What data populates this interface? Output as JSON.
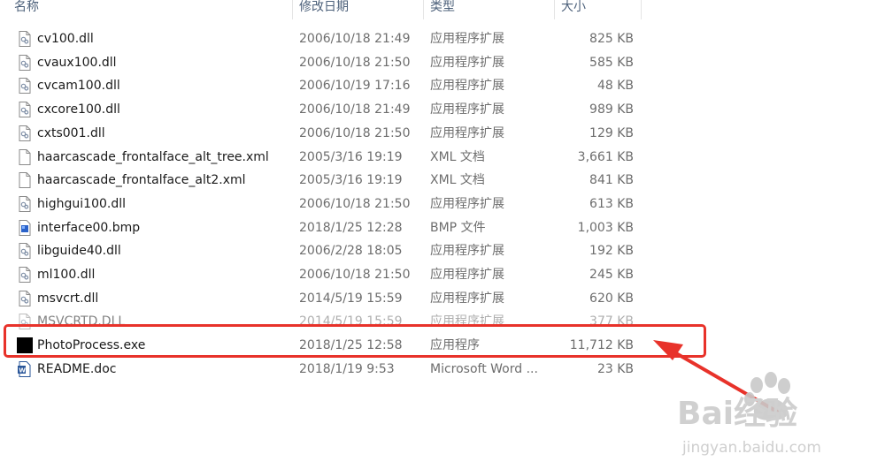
{
  "columns": {
    "name": "名称",
    "date": "修改日期",
    "type": "类型",
    "size": "大小"
  },
  "files": [
    {
      "name": "cv100.dll",
      "date": "2006/10/18 21:49",
      "type": "应用程序扩展",
      "size": "825 KB",
      "icon": "dll-icon"
    },
    {
      "name": "cvaux100.dll",
      "date": "2006/10/18 21:50",
      "type": "应用程序扩展",
      "size": "585 KB",
      "icon": "dll-icon"
    },
    {
      "name": "cvcam100.dll",
      "date": "2006/10/19 17:16",
      "type": "应用程序扩展",
      "size": "48 KB",
      "icon": "dll-icon"
    },
    {
      "name": "cxcore100.dll",
      "date": "2006/10/18 21:49",
      "type": "应用程序扩展",
      "size": "989 KB",
      "icon": "dll-icon"
    },
    {
      "name": "cxts001.dll",
      "date": "2006/10/18 21:50",
      "type": "应用程序扩展",
      "size": "129 KB",
      "icon": "dll-icon"
    },
    {
      "name": "haarcascade_frontalface_alt_tree.xml",
      "date": "2005/3/16 19:19",
      "type": "XML 文档",
      "size": "3,661 KB",
      "icon": "xml-file-icon"
    },
    {
      "name": "haarcascade_frontalface_alt2.xml",
      "date": "2005/3/16 19:19",
      "type": "XML 文档",
      "size": "841 KB",
      "icon": "xml-file-icon"
    },
    {
      "name": "highgui100.dll",
      "date": "2006/10/18 21:50",
      "type": "应用程序扩展",
      "size": "613 KB",
      "icon": "dll-icon"
    },
    {
      "name": "interface00.bmp",
      "date": "2018/1/25 12:28",
      "type": "BMP 文件",
      "size": "1,003 KB",
      "icon": "bmp-file-icon"
    },
    {
      "name": "libguide40.dll",
      "date": "2006/2/28 18:05",
      "type": "应用程序扩展",
      "size": "192 KB",
      "icon": "dll-icon"
    },
    {
      "name": "ml100.dll",
      "date": "2006/10/18 21:50",
      "type": "应用程序扩展",
      "size": "245 KB",
      "icon": "dll-icon"
    },
    {
      "name": "msvcrt.dll",
      "date": "2014/5/19 15:59",
      "type": "应用程序扩展",
      "size": "620 KB",
      "icon": "dll-icon"
    },
    {
      "name": "MSVCRTD.DLL",
      "date": "2014/5/19 15:59",
      "type": "应用程序扩展",
      "size": "377 KB",
      "icon": "dll-icon"
    },
    {
      "name": "PhotoProcess.exe",
      "date": "2018/1/25 12:58",
      "type": "应用程序",
      "size": "11,712 KB",
      "icon": "exe-icon"
    },
    {
      "name": "README.doc",
      "date": "2018/1/19 9:53",
      "type": "Microsoft Word ...",
      "size": "23 KB",
      "icon": "word-doc-icon"
    }
  ],
  "annotation": {
    "highlight_color": "#e8322a"
  },
  "watermark": {
    "brand": "Bai经验",
    "url": "jingyan.baidu.com"
  }
}
